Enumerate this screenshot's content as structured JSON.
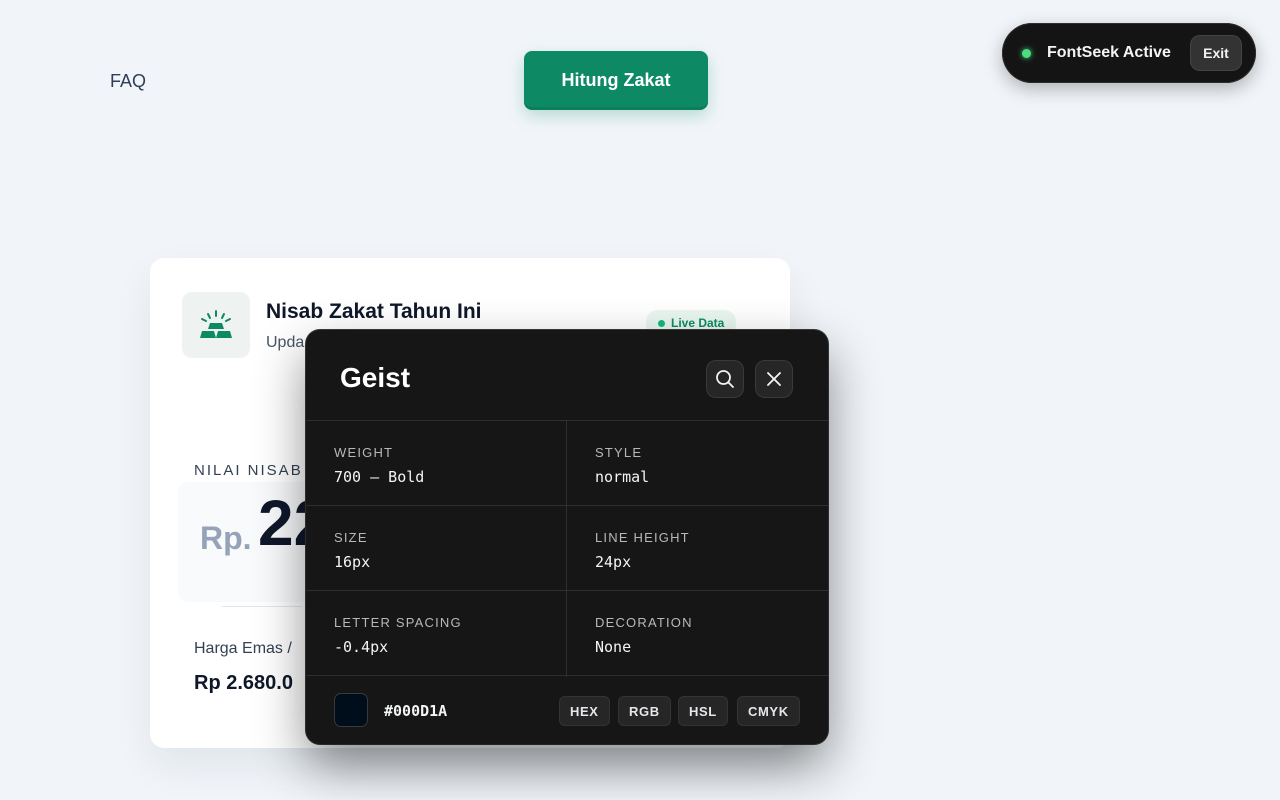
{
  "nav": {
    "faq_label": "FAQ",
    "cta_label": "Hitung Zakat"
  },
  "extension": {
    "status_label": "FontSeek Active",
    "exit_label": "Exit",
    "status_color": "#4ade80"
  },
  "card": {
    "title": "Nisab Zakat Tahun Ini",
    "subtitle": "Upda",
    "live_badge": "Live Data",
    "nisab_label": "NILAI NISAB",
    "currency_prefix": "Rp.",
    "amount_partial": "22",
    "gold_price_label": "Harga Emas / ",
    "gold_price_value": "Rp 2.680.0",
    "icon": "gold-bars-icon",
    "accent_color": "#0d8a63"
  },
  "inspector": {
    "font_name": "Geist",
    "properties": [
      {
        "label": "WEIGHT",
        "value": "700 — Bold"
      },
      {
        "label": "STYLE",
        "value": "normal"
      },
      {
        "label": "SIZE",
        "value": "16px"
      },
      {
        "label": "LINE HEIGHT",
        "value": "24px"
      },
      {
        "label": "LETTER SPACING",
        "value": "-0.4px"
      },
      {
        "label": "DECORATION",
        "value": "None"
      }
    ],
    "color_hex": "#000D1A",
    "color_formats": [
      "HEX",
      "RGB",
      "HSL",
      "CMYK"
    ]
  }
}
